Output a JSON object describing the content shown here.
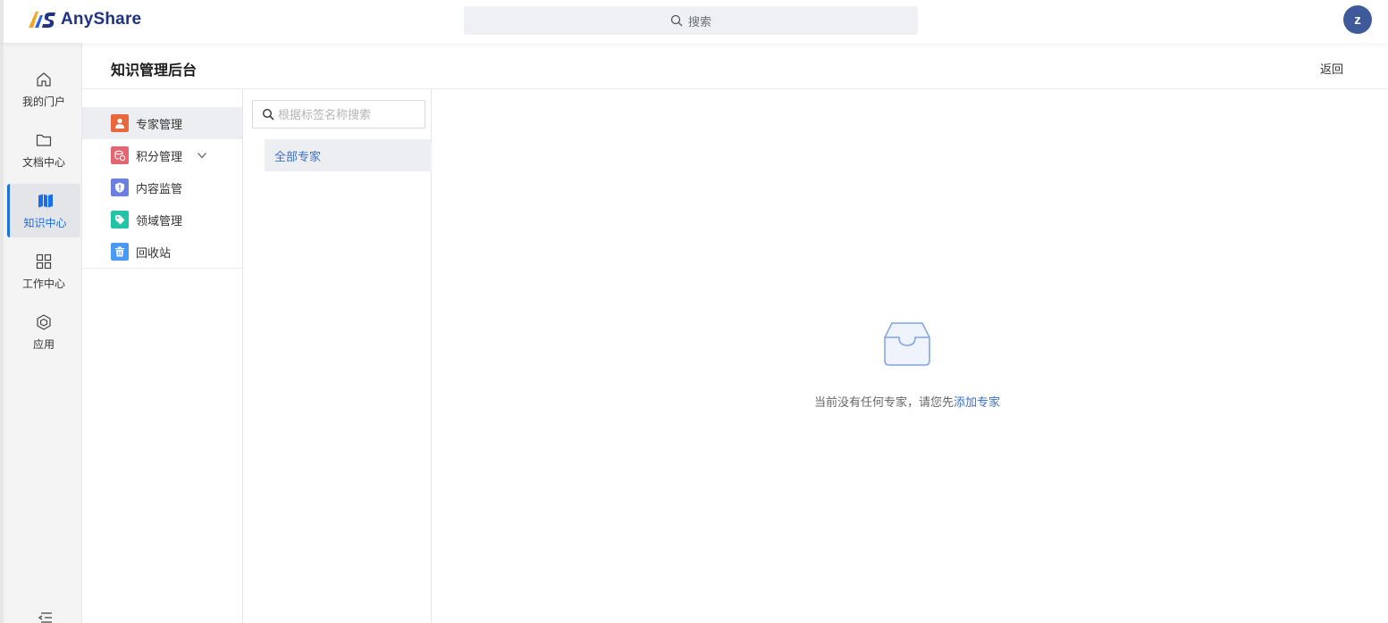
{
  "app": {
    "logo_text": "AnyShare",
    "brand_color": "#1f3380",
    "accent_color": "#1c6ee8"
  },
  "topbar": {
    "search_placeholder": "搜索",
    "avatar_letter": "z"
  },
  "leftnav": {
    "items": [
      {
        "label": "我的门户",
        "icon": "home-icon"
      },
      {
        "label": "文档中心",
        "icon": "folder-icon"
      },
      {
        "label": "知识中心",
        "icon": "map-icon",
        "active": true
      },
      {
        "label": "工作中心",
        "icon": "grid-icon"
      },
      {
        "label": "应用",
        "icon": "hexagon-icon"
      }
    ]
  },
  "header": {
    "title": "知识管理后台",
    "back_label": "返回"
  },
  "submenu": {
    "items": [
      {
        "label": "专家管理",
        "icon": "expert-icon",
        "color": "#e8673d",
        "active": true
      },
      {
        "label": "积分管理",
        "icon": "points-icon",
        "color": "#e2656f",
        "expandable": true
      },
      {
        "label": "内容监管",
        "icon": "shield-icon",
        "color": "#6b7fe0"
      },
      {
        "label": "领域管理",
        "icon": "tag-icon",
        "color": "#21c5a6"
      },
      {
        "label": "回收站",
        "icon": "trash-icon",
        "color": "#4a9af5"
      }
    ]
  },
  "tagcol": {
    "search_placeholder": "根据标签名称搜索",
    "items": [
      {
        "label": "全部专家",
        "active": true
      }
    ]
  },
  "empty": {
    "text": "当前没有任何专家，请您先",
    "link": "添加专家"
  }
}
